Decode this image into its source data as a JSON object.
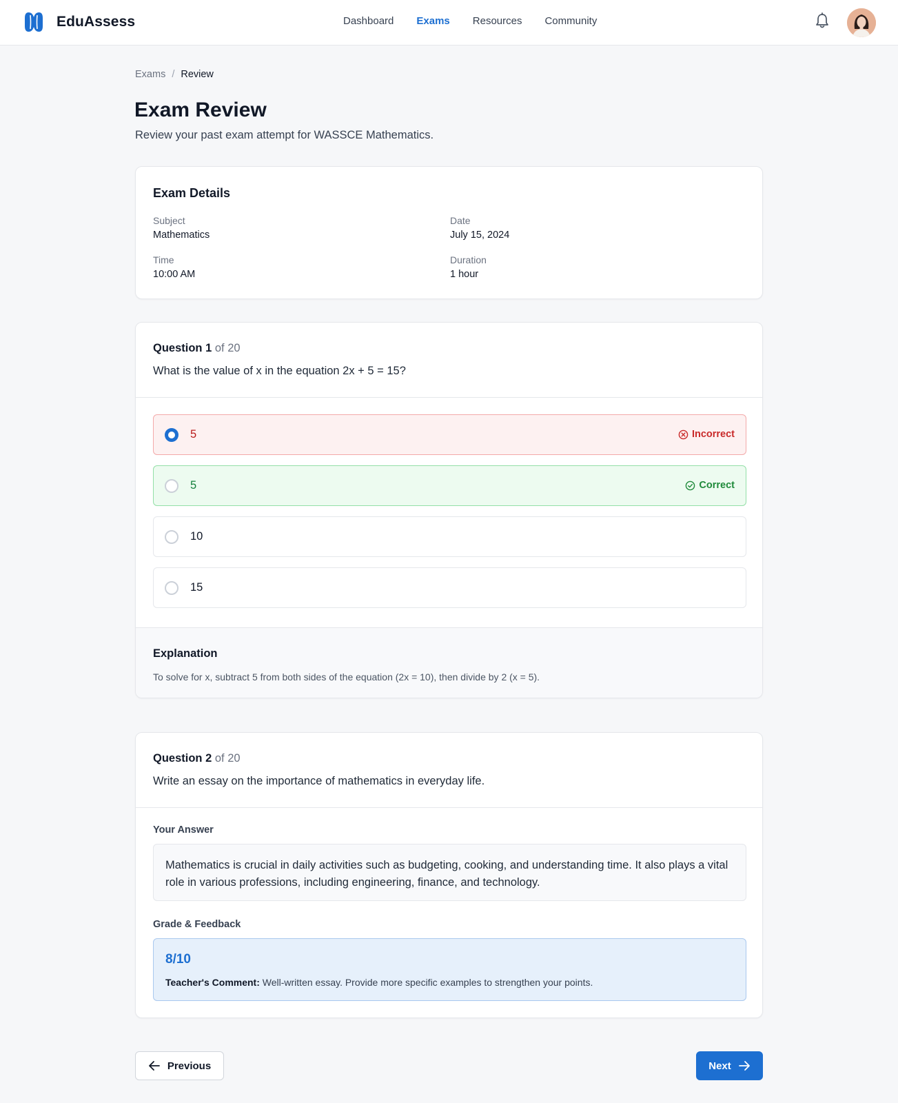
{
  "app": {
    "name": "EduAssess",
    "brand_color": "#1d6fd1"
  },
  "nav": {
    "items": [
      {
        "label": "Dashboard",
        "active": false
      },
      {
        "label": "Exams",
        "active": true
      },
      {
        "label": "Resources",
        "active": false
      },
      {
        "label": "Community",
        "active": false
      }
    ]
  },
  "header_icons": {
    "notifications": "bell-icon",
    "profile": "avatar"
  },
  "breadcrumb": {
    "parent": "Exams",
    "separator": "/",
    "current": "Review"
  },
  "page": {
    "title": "Exam Review",
    "subtitle": "Review your past exam attempt for WASSCE Mathematics."
  },
  "details": {
    "title": "Exam Details",
    "subject_label": "Subject",
    "subject_value": "Mathematics",
    "date_label": "Date",
    "date_value": "July 15, 2024",
    "time_label": "Time",
    "time_value": "10:00 AM",
    "duration_label": "Duration",
    "duration_value": "1 hour"
  },
  "question1": {
    "number": "Question 1",
    "of": "of 20",
    "text": "What is the value of x in the equation 2x + 5 = 15?",
    "options": [
      {
        "text": "5",
        "state": "incorrect",
        "selected": true,
        "status": "Incorrect",
        "status_icon": "x-circle-icon"
      },
      {
        "text": "5",
        "state": "correct",
        "selected": false,
        "status": "Correct",
        "status_icon": "check-circle-icon"
      },
      {
        "text": "10",
        "state": "neutral",
        "selected": false
      },
      {
        "text": "15",
        "state": "neutral",
        "selected": false
      }
    ],
    "explanation_title": "Explanation",
    "explanation": "To solve for x, subtract 5 from both sides of the equation (2x = 10), then divide by 2 (x = 5)."
  },
  "question2": {
    "number": "Question 2",
    "of": "of 20",
    "text": "Write an essay on the importance of mathematics in everyday life.",
    "answer_label": "Your Answer",
    "answer": "Mathematics is crucial in daily activities such as budgeting, cooking, and understanding time. It also plays a vital role in various professions, including engineering, finance, and technology.",
    "grade_label": "Grade & Feedback",
    "score": "8/10",
    "comment_label": "Teacher's Comment:",
    "comment": "Well-written essay. Provide more specific examples to strengthen your points."
  },
  "pager": {
    "previous": "Previous",
    "next": "Next"
  },
  "colors": {
    "incorrect_bg": "#fdf1f1",
    "incorrect_text": "#c92a2a",
    "correct_bg": "#edfbf0",
    "correct_text": "#1f8a3a",
    "feedback_bg": "#e6f0fb"
  }
}
